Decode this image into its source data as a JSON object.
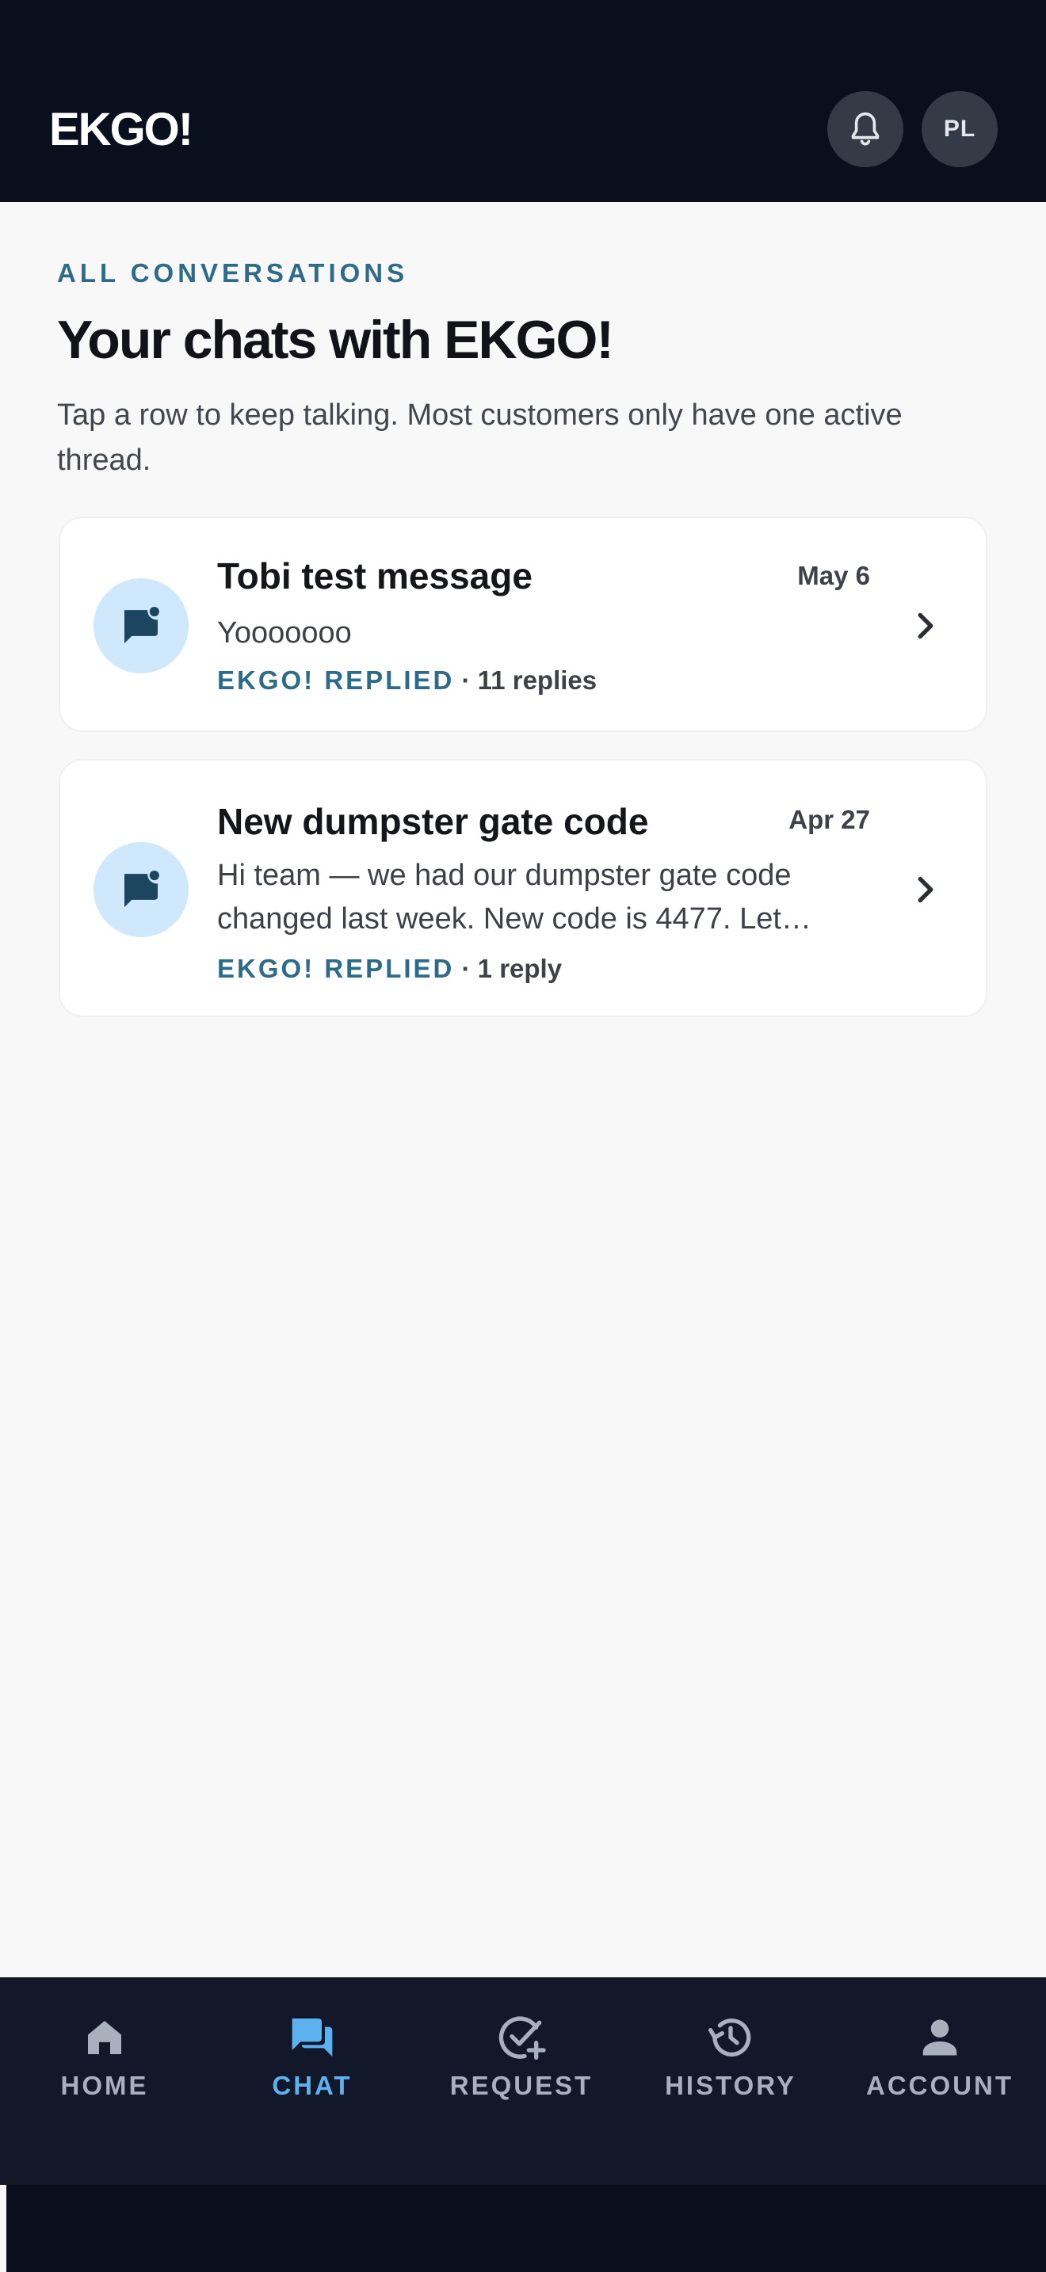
{
  "header": {
    "brand": "EKGO!",
    "bell_icon": "bell-icon",
    "avatar_initials": "PL"
  },
  "intro": {
    "eyebrow": "ALL CONVERSATIONS",
    "title": "Your chats with EKGO!",
    "subtitle": "Tap a row to keep talking. Most customers only have one active thread."
  },
  "conversations": [
    {
      "title": "Tobi test message",
      "date": "May 6",
      "preview": "Yooooooo",
      "status": "EKGO! REPLIED",
      "replies": " · 11 replies",
      "icon": "chat-bubble-dot-icon"
    },
    {
      "title": "New dumpster gate code",
      "date": "Apr 27",
      "preview": "Hi team — we had our dumpster gate code changed last week. New code is 4477. Let…",
      "status": "EKGO! REPLIED",
      "replies": " · 1 reply",
      "icon": "chat-bubble-dot-icon"
    }
  ],
  "nav": {
    "items": [
      {
        "label": "HOME",
        "icon": "home-icon"
      },
      {
        "label": "CHAT",
        "icon": "chat-icon",
        "active": true
      },
      {
        "label": "REQUEST",
        "icon": "request-check-icon"
      },
      {
        "label": "HISTORY",
        "icon": "history-icon"
      },
      {
        "label": "ACCOUNT",
        "icon": "account-icon"
      }
    ]
  },
  "colors": {
    "header_bg": "#0a0f1d",
    "accent": "#2e6b8a",
    "nav_active": "#5bb2ef",
    "nav_inactive": "#a9b0bd",
    "avatar_bg": "#cfe8fb"
  }
}
